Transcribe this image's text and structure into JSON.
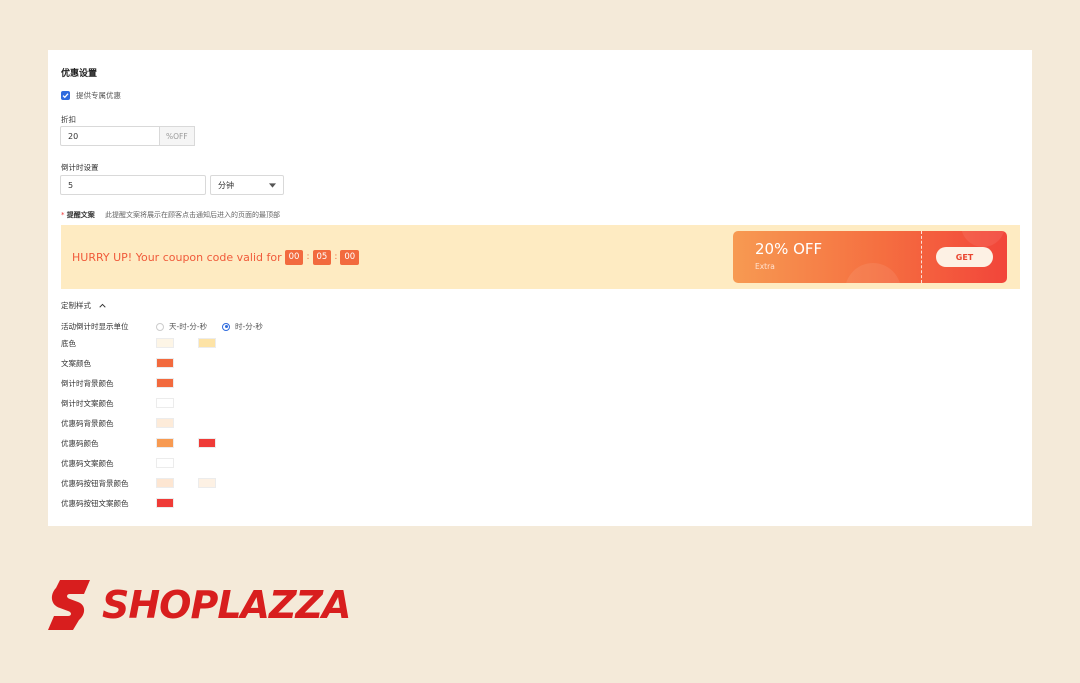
{
  "settings": {
    "title": "优惠设置",
    "exclusive_offer": {
      "label": "提供专属优惠",
      "checked": true
    },
    "discount": {
      "label": "折扣",
      "value": "20",
      "suffix": "%OFF"
    },
    "countdown": {
      "label": "倒计时设置",
      "value": "5",
      "unit": "分钟"
    },
    "reminder": {
      "required_mark": "*",
      "label": "提醒文案",
      "hint": "此提醒文案将展示在顾客点击通知后进入的页面的最顶部"
    }
  },
  "banner": {
    "text": "HURRY UP! Your coupon code valid for",
    "countdown": [
      "00",
      "05",
      "00"
    ],
    "separator": ":",
    "coupon_title": "20% OFF",
    "coupon_sub": "Extra",
    "button_label": "GET"
  },
  "custom_style": {
    "title": "定制样式",
    "unit_label": "活动倒计时显示单位",
    "unit_options": [
      {
        "label": "天-时-分-秒",
        "selected": false
      },
      {
        "label": "时-分-秒",
        "selected": true
      }
    ],
    "rows": [
      {
        "label": "底色",
        "colors": [
          "#fdf5e6",
          "#fde3a6"
        ]
      },
      {
        "label": "文案颜色",
        "colors": [
          "#f26a3e"
        ]
      },
      {
        "label": "倒计时背景颜色",
        "colors": [
          "#f26a3e"
        ]
      },
      {
        "label": "倒计时文案颜色",
        "colors": [
          "#ffffff"
        ]
      },
      {
        "label": "优惠码背景颜色",
        "colors": [
          "#fdebd9"
        ]
      },
      {
        "label": "优惠码颜色",
        "colors": [
          "#f79a52",
          "#ef3b37"
        ]
      },
      {
        "label": "优惠码文案颜色",
        "colors": [
          "#ffffff"
        ]
      },
      {
        "label": "优惠码按钮背景颜色",
        "colors": [
          "#fde6d2",
          "#fdf1e4"
        ]
      },
      {
        "label": "优惠码按钮文案颜色",
        "colors": [
          "#ef3b37"
        ]
      }
    ]
  },
  "brand": {
    "name": "SHOPLAZZA",
    "color": "#d81e1e"
  }
}
